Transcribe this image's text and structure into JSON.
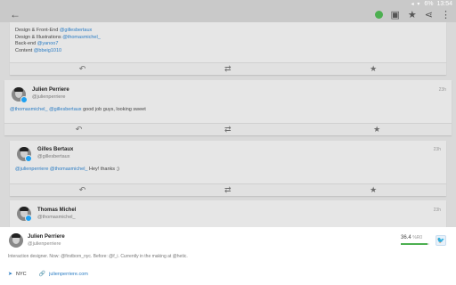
{
  "status_bar": {
    "time": "13:54",
    "battery": "6%",
    "icons": "◂ ▾"
  },
  "toolbar": {
    "back_icon": "arrow-back-icon",
    "share_icon": "share-icon",
    "star_icon": "star-icon",
    "more_icon": "more-vertical-icon"
  },
  "tweets": [
    {
      "lines": [
        {
          "text": "Design & Front-End ",
          "mention": "@gillesbertaux"
        },
        {
          "text": "Design & Illustrations ",
          "mention": "@thomasmichel_"
        },
        {
          "text": "Back-end ",
          "mention": "@yanoo7"
        },
        {
          "text": "Content ",
          "mention": "@bbeig1010"
        }
      ]
    },
    {
      "name": "Julien Perriere",
      "handle": "@julienperriere",
      "time": "23h",
      "mention": "@thomasmichel_ @gillesbertaux",
      "text": " good job guys, looking sweet"
    },
    {
      "name": "Gilles Bertaux",
      "handle": "@gillesbertaux",
      "time": "23h",
      "mention": "@julienperriere @thomasmichel_",
      "text": " Hey! thanks ;)"
    },
    {
      "name": "Thomas Michel",
      "handle": "@thomasmichel_",
      "time": "23h"
    }
  ],
  "actions": {
    "reply": "↶",
    "retweet": "⇄",
    "favorite": "★"
  },
  "profile": {
    "name": "Julien Perriere",
    "handle": "@julienperriere",
    "bio": "Interaction designer. Now: @firstborn_nyc. Before: @f_i. Currently in the making at @hetic.",
    "location": "NYC",
    "link": "julienperriere.com",
    "followers": "36.4",
    "followers_unit": "%R0",
    "progress": 0.95,
    "colors": {
      "accent": "#1da1f2",
      "link": "#2a7cc4",
      "progress": "#4caf50"
    }
  }
}
